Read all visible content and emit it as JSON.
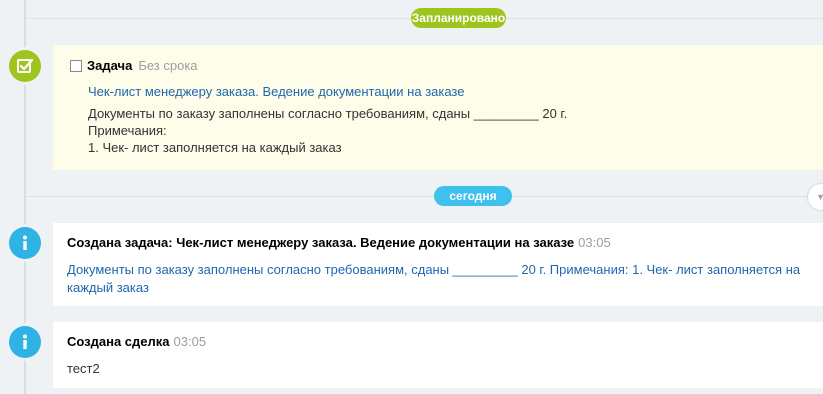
{
  "planned_label": "Запланировано",
  "today_label": "сегодня",
  "task": {
    "type_label": "Задача",
    "deadline": "Без срока",
    "title": "Чек-лист менеджеру заказа. Ведение документации на заказе",
    "body": "Документы по заказу заполнены согласно требованиям, сданы _________ 20     г.\nПримечания:\n1. Чек- лист заполняется на каждый заказ"
  },
  "events": [
    {
      "title": "Создана задача: Чек-лист менеджеру заказа. Ведение документации на заказе",
      "time": "03:05",
      "description": "Документы по заказу заполнены согласно требованиям, сданы _________ 20     г. Примечания: 1. Чек- лист заполняется на каждый заказ"
    },
    {
      "title": "Создана сделка",
      "time": "03:05",
      "description": "тест2"
    }
  ],
  "icons": {
    "task_node": "task-check-icon",
    "info_node": "info-icon",
    "collapse": "chevron-down-icon"
  },
  "colors": {
    "green": "#a0c41e",
    "blue": "#3ec1ec",
    "link": "#2067b0",
    "task_bg": "#fdfde9"
  }
}
